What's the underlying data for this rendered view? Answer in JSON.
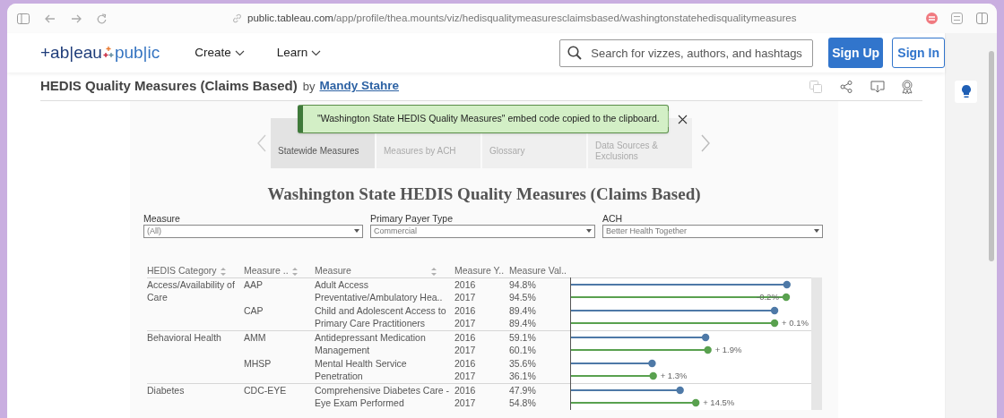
{
  "browser": {
    "url_host": "public.tableau.com",
    "url_path": "/app/profile/thea.mounts/viz/hedisqualitymeasuresclaimsbased/washingtonstatehedisqualitymeasures"
  },
  "nav": {
    "logo_left": "+ab|eau",
    "logo_right": "pub|ic",
    "menus": [
      "Create",
      "Learn"
    ],
    "search": {
      "placeholder": "Search for vizzes, authors, and hashtags"
    },
    "sign_up": "Sign Up",
    "sign_in": "Sign In"
  },
  "viz_header": {
    "title": "HEDIS Quality Measures (Claims Based)",
    "by": "by",
    "author": "Mandy Stahre"
  },
  "toast": {
    "message": "\"Washington State HEDIS Quality Measures\" embed code copied to the clipboard."
  },
  "tabs": [
    {
      "label": "Statewide Measures",
      "selected": true
    },
    {
      "label": "Measures by ACH",
      "selected": false
    },
    {
      "label": "Glossary",
      "selected": false
    },
    {
      "label": "Data Sources & Exclusions",
      "selected": false
    }
  ],
  "dashboard": {
    "title": "Washington State HEDIS Quality Measures (Claims Based)",
    "filters": [
      {
        "label": "Measure",
        "value": "(All)"
      },
      {
        "label": "Primary Payer Type",
        "value": "Commercial"
      },
      {
        "label": "ACH",
        "value": "Better Health Together"
      }
    ],
    "columns": [
      {
        "label": "HEDIS Category",
        "sortable": true
      },
      {
        "label": "Measure ..",
        "sortable": true
      },
      {
        "label": "Measure",
        "sortable": true
      },
      {
        "label": "Measure Y..",
        "sortable": false
      },
      {
        "label": "Measure Val..",
        "sortable": false
      }
    ],
    "groups": [
      {
        "category": "Access/Availability of Care",
        "measures": [
          {
            "code": "AAP",
            "rows": [
              {
                "measure": "Adult Access",
                "year": "2016",
                "value": "94.8%",
                "color": "#4e79a7"
              },
              {
                "measure": "Preventative/Ambulatory Hea..",
                "year": "2017",
                "value": "94.5%",
                "change": "-0.2%",
                "color": "#59a14f"
              }
            ]
          },
          {
            "code": "CAP",
            "rows": [
              {
                "measure": "Child and Adolescent Access to",
                "year": "2016",
                "value": "89.4%",
                "color": "#4e79a7"
              },
              {
                "measure": "Primary Care Practitioners",
                "year": "2017",
                "value": "89.4%",
                "change": "+ 0.1%",
                "color": "#59a14f"
              }
            ]
          }
        ]
      },
      {
        "category": "Behavioral Health",
        "measures": [
          {
            "code": "AMM",
            "rows": [
              {
                "measure": "Antidepressant Medication",
                "year": "2016",
                "value": "59.1%",
                "color": "#4e79a7"
              },
              {
                "measure": "Management",
                "year": "2017",
                "value": "60.1%",
                "change": "+ 1.9%",
                "color": "#59a14f"
              }
            ]
          },
          {
            "code": "MHSP",
            "rows": [
              {
                "measure": "Mental Health Service",
                "year": "2016",
                "value": "35.6%",
                "color": "#4e79a7"
              },
              {
                "measure": "Penetration",
                "year": "2017",
                "value": "36.1%",
                "change": "+ 1.3%",
                "color": "#59a14f"
              }
            ]
          }
        ]
      },
      {
        "category": "Diabetes",
        "measures": [
          {
            "code": "CDC-EYE",
            "rows": [
              {
                "measure": "Comprehensive Diabetes Care -",
                "year": "2016",
                "value": "47.9%",
                "color": "#4e79a7"
              },
              {
                "measure": "Eye Exam Performed",
                "year": "2017",
                "value": "54.8%",
                "change": "+ 14.5%",
                "color": "#59a14f"
              }
            ]
          }
        ]
      }
    ]
  }
}
